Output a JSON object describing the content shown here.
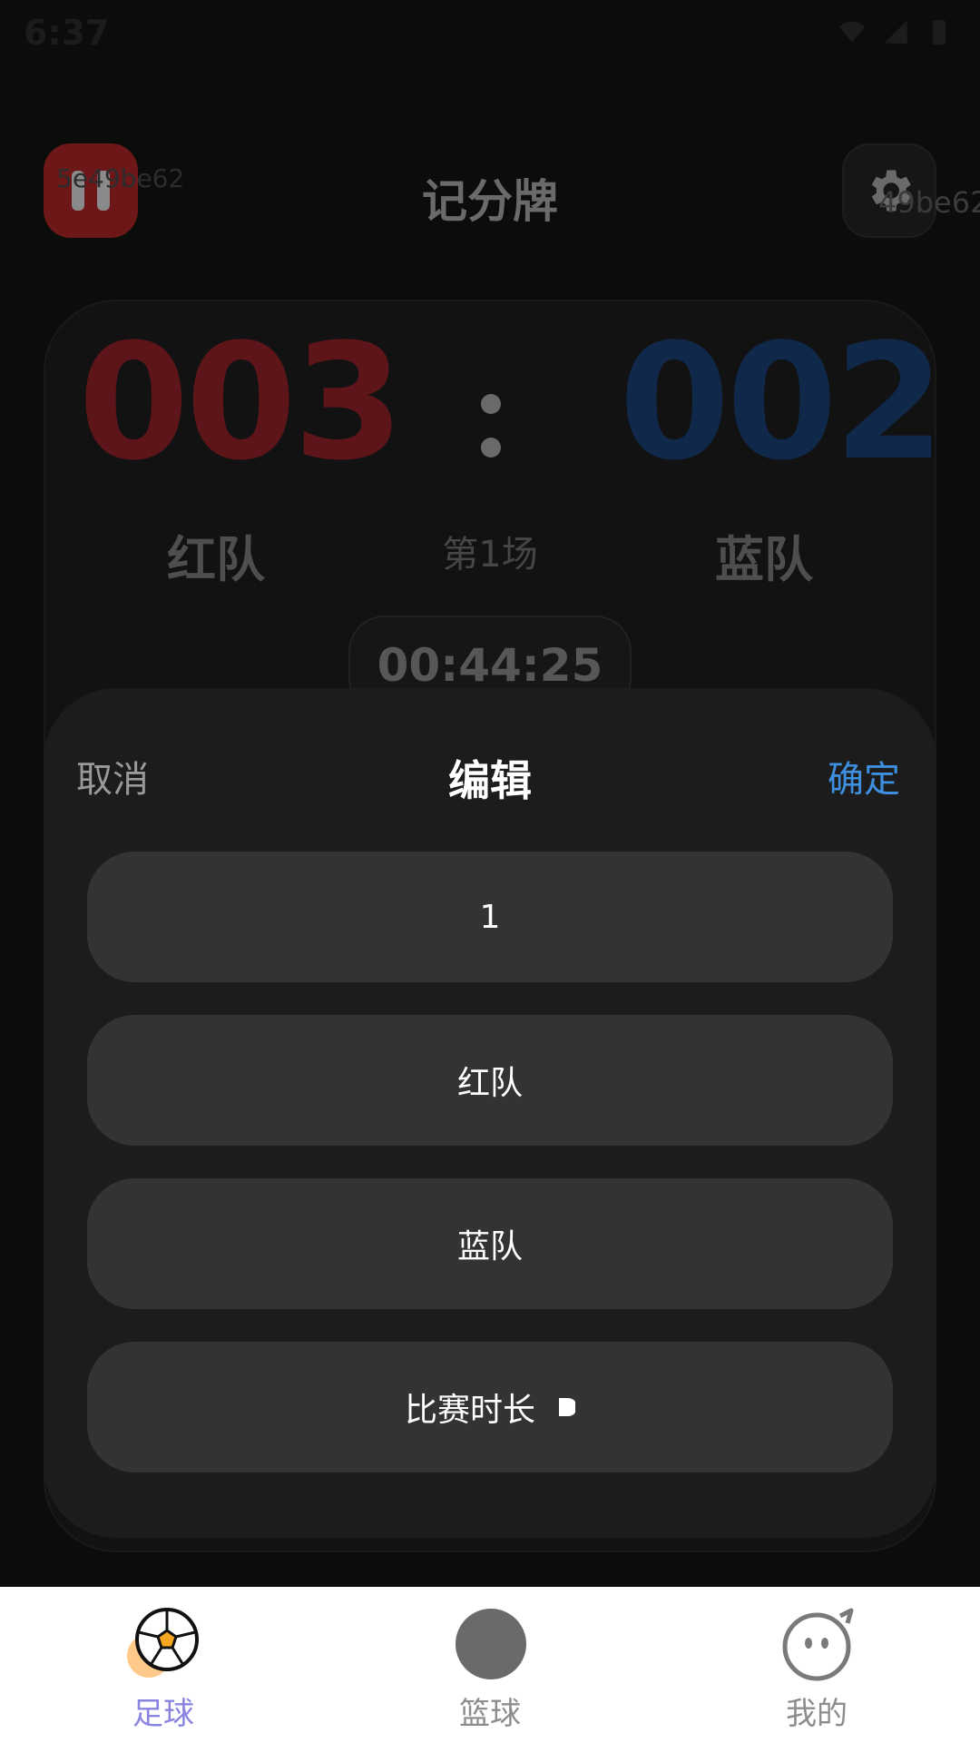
{
  "status_bar": {
    "time": "6:37"
  },
  "header": {
    "title": "记分牌",
    "id_left": "5e49be62",
    "id_right": "49be62",
    "pause_icon": "pause-icon",
    "settings_icon": "gear-icon"
  },
  "scoreboard": {
    "red_score": "003",
    "blue_score": "002",
    "separator": ":",
    "red_team": "红队",
    "blue_team": "蓝队",
    "match_label": "第1场",
    "timer": "00:44:25"
  },
  "edit_sheet": {
    "cancel_label": "取消",
    "title": "编辑",
    "confirm_label": "确定",
    "match_number_value": "1",
    "red_team_value": "红队",
    "blue_team_value": "蓝队",
    "duration_label": "比赛时长"
  },
  "bottom_nav": {
    "items": [
      {
        "label": "足球",
        "icon": "soccer-ball-icon",
        "active": true
      },
      {
        "label": "篮球",
        "icon": "basketball-icon",
        "active": false
      },
      {
        "label": "我的",
        "icon": "profile-face-icon",
        "active": false
      }
    ]
  },
  "colors": {
    "red_score": "#5d1519",
    "blue_score": "#10294a",
    "confirm": "#3e8fe0",
    "active_nav": "#8884e0",
    "sheet_bg": "#1c1c1c",
    "field_bg": "#333333"
  }
}
